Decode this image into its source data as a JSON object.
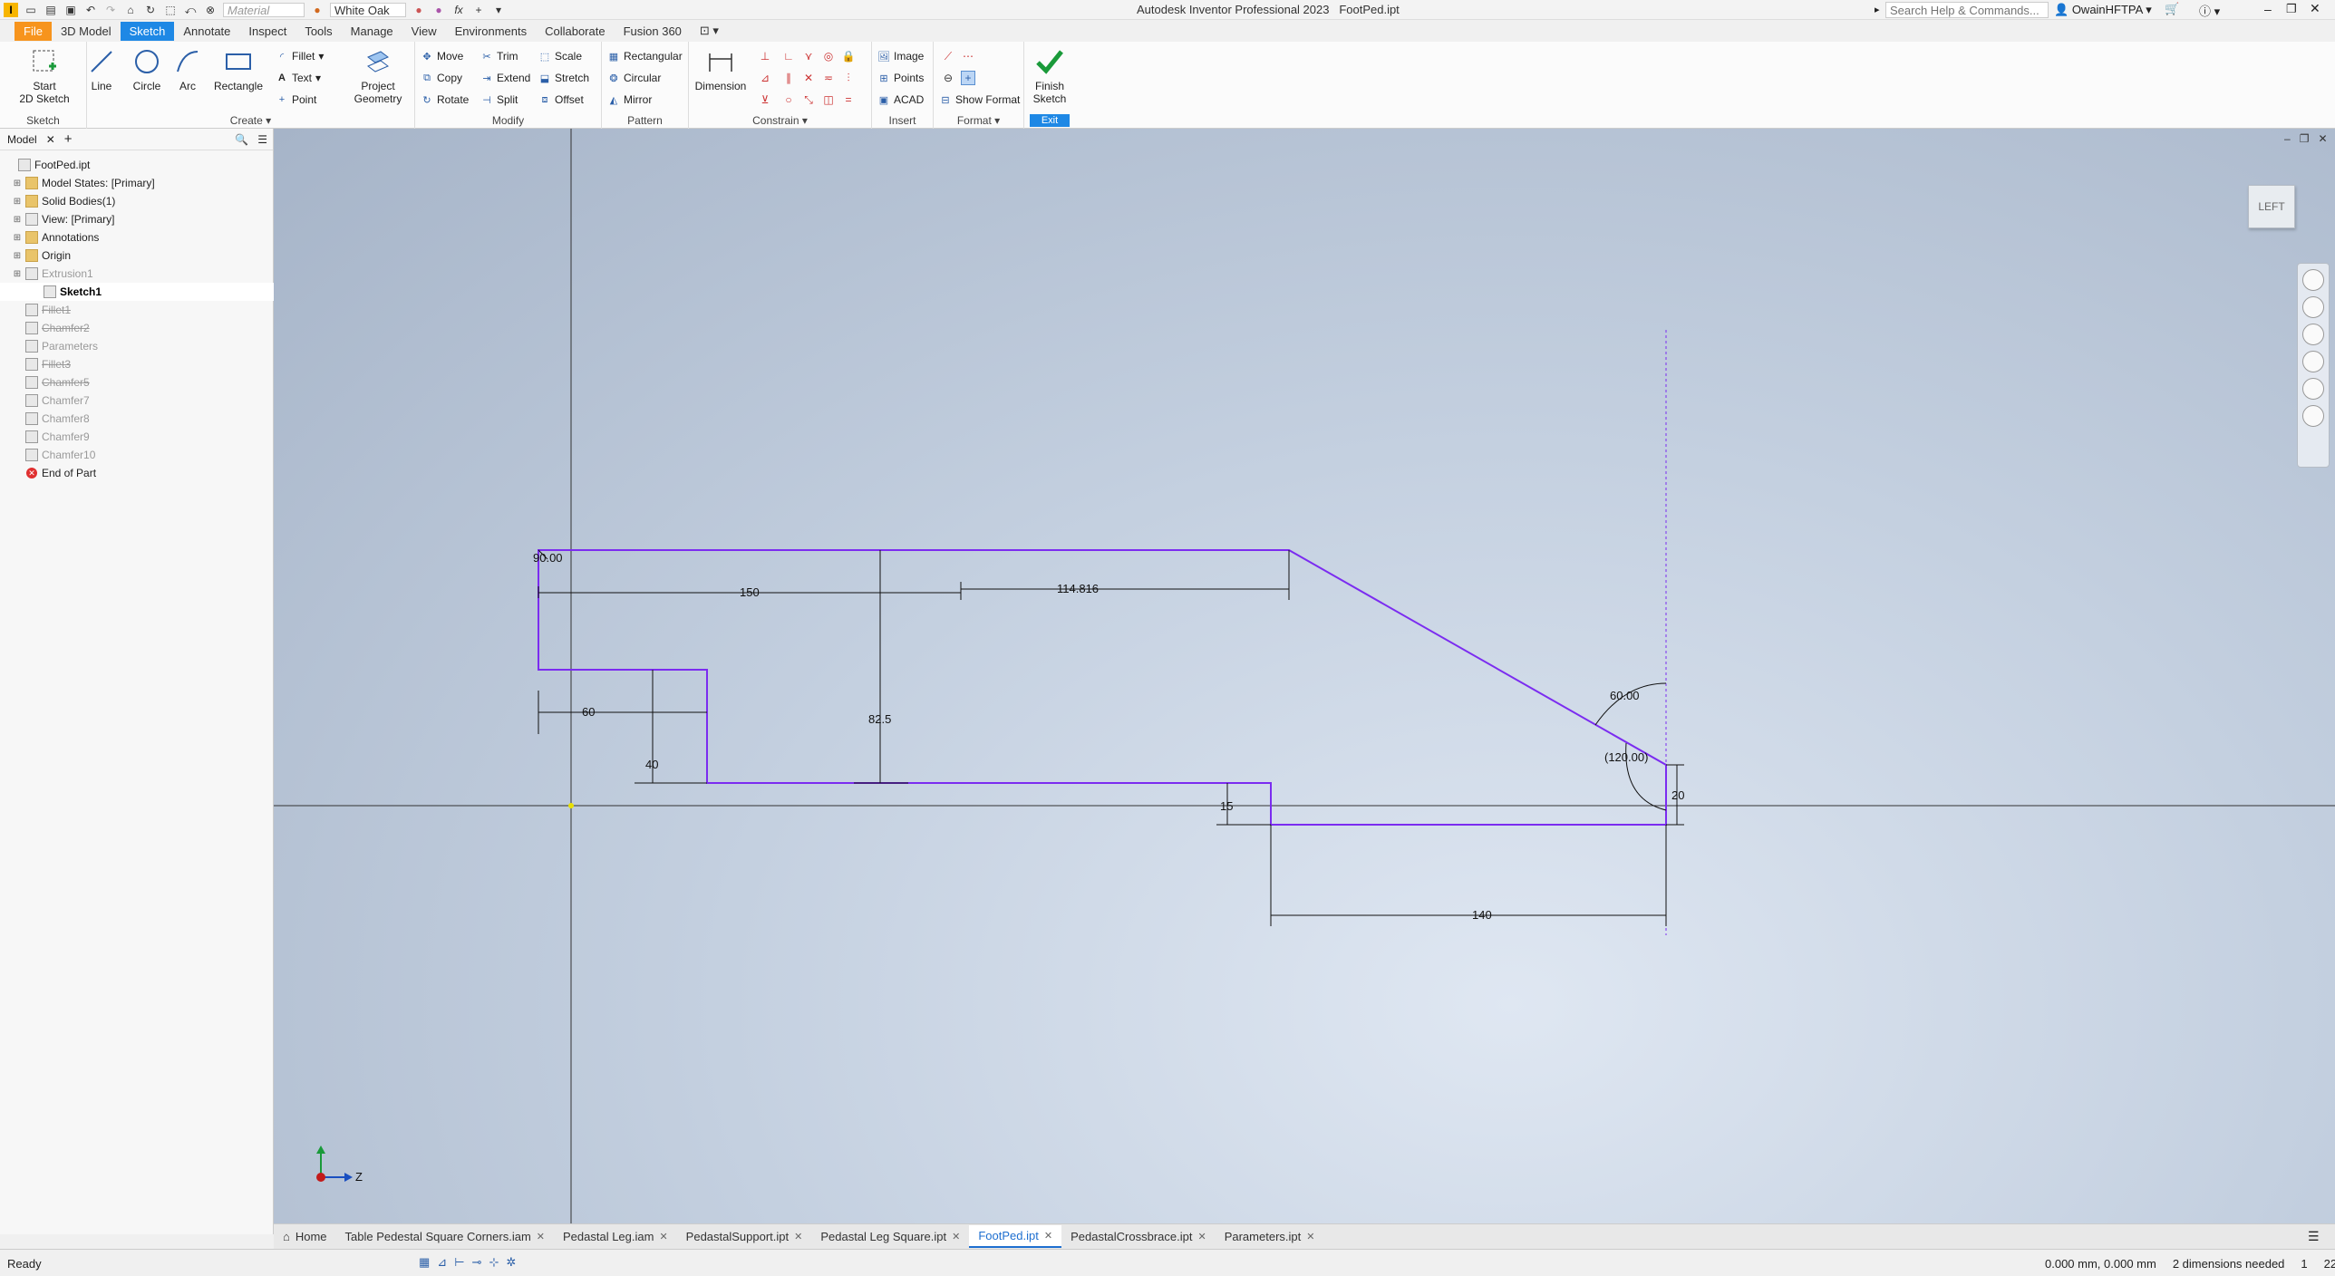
{
  "titlebar": {
    "app_title": "Autodesk Inventor Professional 2023",
    "file_name": "FootPed.ipt",
    "material_placeholder": "Material",
    "appearance": "White Oak",
    "search_placeholder": "Search Help & Commands...",
    "user": "OwainHFTPA"
  },
  "tabs": [
    "File",
    "3D Model",
    "Sketch",
    "Annotate",
    "Inspect",
    "Tools",
    "Manage",
    "View",
    "Environments",
    "Collaborate",
    "Fusion 360"
  ],
  "active_tab": "Sketch",
  "ribbon": {
    "sketch": {
      "start_line1": "Start",
      "start_line2": "2D Sketch",
      "label": "Sketch"
    },
    "create": {
      "line": "Line",
      "circle": "Circle",
      "arc": "Arc",
      "rectangle": "Rectangle",
      "fillet": "Fillet",
      "text": "Text",
      "point": "Point",
      "project_line1": "Project",
      "project_line2": "Geometry",
      "label": "Create"
    },
    "modify": {
      "move": "Move",
      "copy": "Copy",
      "rotate": "Rotate",
      "trim": "Trim",
      "extend": "Extend",
      "split": "Split",
      "scale": "Scale",
      "stretch": "Stretch",
      "offset": "Offset",
      "label": "Modify"
    },
    "pattern": {
      "rectangular": "Rectangular",
      "circular": "Circular",
      "mirror": "Mirror",
      "label": "Pattern"
    },
    "constrain": {
      "dimension": "Dimension",
      "label": "Constrain"
    },
    "insert": {
      "image": "Image",
      "points": "Points",
      "acad": "ACAD",
      "label": "Insert"
    },
    "format": {
      "show_format": "Show Format",
      "label": "Format"
    },
    "exit": {
      "finish_line1": "Finish",
      "finish_line2": "Sketch",
      "label": "Exit"
    }
  },
  "browser": {
    "tab": "Model",
    "nodes": [
      {
        "label": "FootPed.ipt",
        "style": "root"
      },
      {
        "label": "Model States: [Primary]",
        "style": "folder"
      },
      {
        "label": "Solid Bodies(1)",
        "style": "folder"
      },
      {
        "label": "View: [Primary]",
        "style": "normal"
      },
      {
        "label": "Annotations",
        "style": "folder"
      },
      {
        "label": "Origin",
        "style": "folder"
      },
      {
        "label": "Extrusion1",
        "style": "grey"
      },
      {
        "label": "Sketch1",
        "style": "sel"
      },
      {
        "label": "Fillet1",
        "style": "strike"
      },
      {
        "label": "Chamfer2",
        "style": "strike"
      },
      {
        "label": "Parameters",
        "style": "grey"
      },
      {
        "label": "Fillet3",
        "style": "strike"
      },
      {
        "label": "Chamfer5",
        "style": "strike"
      },
      {
        "label": "Chamfer7",
        "style": "grey"
      },
      {
        "label": "Chamfer8",
        "style": "grey"
      },
      {
        "label": "Chamfer9",
        "style": "grey"
      },
      {
        "label": "Chamfer10",
        "style": "grey"
      },
      {
        "label": "End of Part",
        "style": "end"
      }
    ]
  },
  "viewcube": "LEFT",
  "sketch_dims": {
    "d90": "90.00",
    "d150": "150",
    "d114": "114.816",
    "d60": "60",
    "d40": "40",
    "d825": "82.5",
    "d15": "15",
    "d60deg": "60.00",
    "d120": "(120.00)",
    "d20": "20",
    "d140": "140"
  },
  "triad": {
    "z": "Z"
  },
  "doc_tabs": [
    {
      "label": "Home",
      "active": false,
      "close": false
    },
    {
      "label": "Table Pedestal Square Corners.iam",
      "active": false,
      "close": true
    },
    {
      "label": "Pedastal Leg.iam",
      "active": false,
      "close": true
    },
    {
      "label": "PedastalSupport.ipt",
      "active": false,
      "close": true
    },
    {
      "label": "Pedastal Leg Square.ipt",
      "active": false,
      "close": true
    },
    {
      "label": "FootPed.ipt",
      "active": true,
      "close": true
    },
    {
      "label": "PedastalCrossbrace.ipt",
      "active": false,
      "close": true
    },
    {
      "label": "Parameters.ipt",
      "active": false,
      "close": true
    }
  ],
  "status": {
    "ready": "Ready",
    "coords": "0.000 mm, 0.000 mm",
    "dims_needed": "2 dimensions needed",
    "n1": "1",
    "n2": "22"
  },
  "colors": {
    "sketch": "#7b2cf0",
    "accent": "#1e88e5",
    "file_tab": "#f7941d"
  }
}
